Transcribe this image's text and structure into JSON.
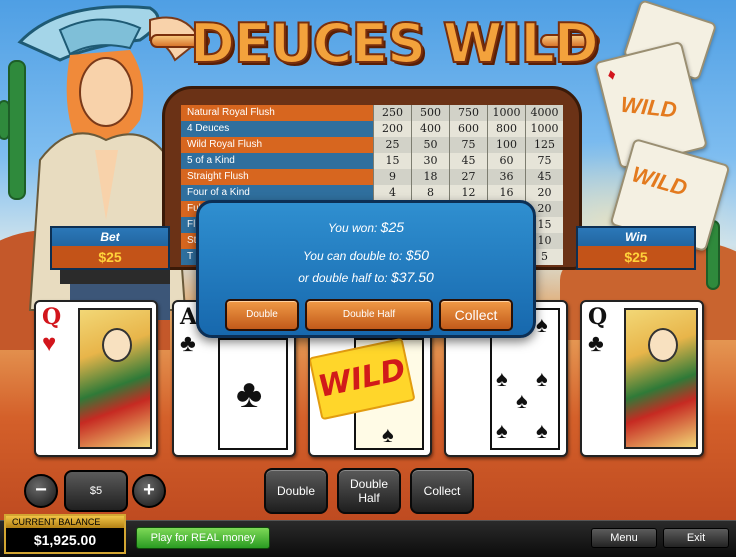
{
  "game": {
    "title": "DEUCES WILD"
  },
  "paytable": {
    "rows": [
      {
        "hand": "Natural Royal Flush",
        "payouts": [
          "250",
          "500",
          "750",
          "1000",
          "4000"
        ]
      },
      {
        "hand": "4 Deuces",
        "payouts": [
          "200",
          "400",
          "600",
          "800",
          "1000"
        ]
      },
      {
        "hand": "Wild Royal Flush",
        "payouts": [
          "25",
          "50",
          "75",
          "100",
          "125"
        ]
      },
      {
        "hand": "5 of a Kind",
        "payouts": [
          "15",
          "30",
          "45",
          "60",
          "75"
        ]
      },
      {
        "hand": "Straight Flush",
        "payouts": [
          "9",
          "18",
          "27",
          "36",
          "45"
        ]
      },
      {
        "hand": "Four of a Kind",
        "payouts": [
          "4",
          "8",
          "12",
          "16",
          "20"
        ]
      },
      {
        "hand": "Ful",
        "payouts": [
          "",
          "",
          "",
          "",
          "20"
        ]
      },
      {
        "hand": "Flu",
        "payouts": [
          "",
          "",
          "",
          "",
          "15"
        ]
      },
      {
        "hand": "St",
        "payouts": [
          "",
          "",
          "",
          "",
          "10"
        ]
      },
      {
        "hand": "T",
        "payouts": [
          "",
          "",
          "",
          "",
          "5"
        ]
      }
    ]
  },
  "bet_panel": {
    "label": "Bet",
    "value": "$25"
  },
  "win_panel": {
    "label": "Win",
    "value": "$25"
  },
  "dialog": {
    "won_label": "You won:",
    "won_value": "$25",
    "double_label": "You can double to:",
    "double_value": "$50",
    "half_label": "or double half to:",
    "half_value": "$37.50",
    "buttons": {
      "double": "Double",
      "double_half": "Double Half",
      "collect": "Collect"
    }
  },
  "cards": [
    {
      "rank": "Q",
      "suit": "♥",
      "color": "#d2151c",
      "kind": "face"
    },
    {
      "rank": "A",
      "suit": "♣",
      "color": "#111111",
      "kind": "ace"
    },
    {
      "rank": "",
      "suit": "♠",
      "color": "#111111",
      "kind": "wild",
      "wild_text": "WILD"
    },
    {
      "rank": "",
      "suit": "♠",
      "color": "#111111",
      "kind": "five"
    },
    {
      "rank": "Q",
      "suit": "♣",
      "color": "#111111",
      "kind": "face"
    }
  ],
  "controls": {
    "minus": "−",
    "plus": "+",
    "bet_amount": "$5",
    "double": "Double",
    "double_half_line1": "Double",
    "double_half_line2": "Half",
    "collect": "Collect"
  },
  "footer": {
    "balance_label": "CURRENT BALANCE",
    "balance_value": "$1,925.00",
    "real_money": "Play for REAL money",
    "menu": "Menu",
    "exit": "Exit"
  },
  "decor": {
    "background_cards": [
      "WILD",
      "WILD"
    ]
  },
  "colors": {
    "accent_orange": "#d7661f",
    "panel_blue": "#1768ad",
    "gold": "#ffd23a",
    "green": "#2a9b22"
  }
}
